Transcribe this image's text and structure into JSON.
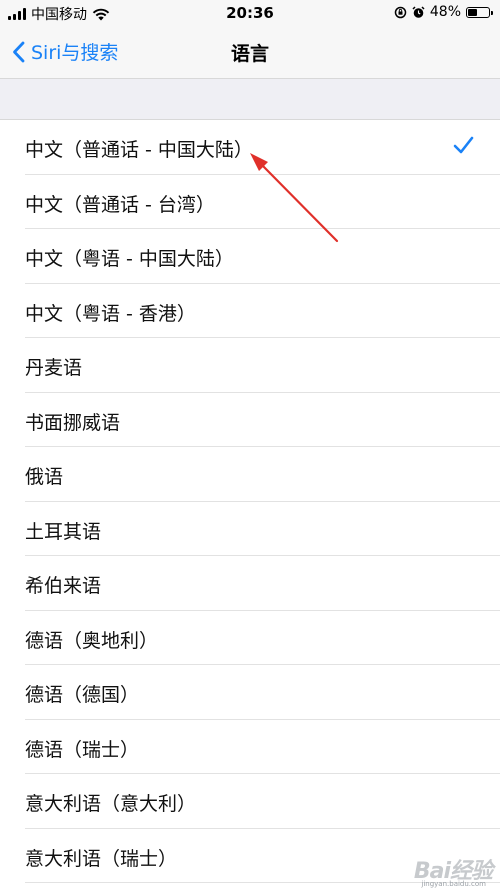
{
  "status_bar": {
    "carrier": "中国移动",
    "time": "20:36",
    "battery_percent": "48%",
    "battery_level": 0.48,
    "icons": [
      "signal-icon",
      "wifi-icon",
      "lock-rotation-icon",
      "alarm-icon",
      "battery-icon"
    ]
  },
  "nav": {
    "back_label": "Siri与搜索",
    "title": "语言"
  },
  "accent_color": "#1a82f7",
  "languages": [
    {
      "label": "中文（普通话 - 中国大陆）",
      "selected": true
    },
    {
      "label": "中文（普通话 - 台湾）",
      "selected": false
    },
    {
      "label": "中文（粤语 - 中国大陆）",
      "selected": false
    },
    {
      "label": "中文（粤语 - 香港）",
      "selected": false
    },
    {
      "label": "丹麦语",
      "selected": false
    },
    {
      "label": "书面挪威语",
      "selected": false
    },
    {
      "label": "俄语",
      "selected": false
    },
    {
      "label": "土耳其语",
      "selected": false
    },
    {
      "label": "希伯来语",
      "selected": false
    },
    {
      "label": "德语（奥地利）",
      "selected": false
    },
    {
      "label": "德语（德国）",
      "selected": false
    },
    {
      "label": "德语（瑞士）",
      "selected": false
    },
    {
      "label": "意大利语（意大利）",
      "selected": false
    },
    {
      "label": "意大利语（瑞士）",
      "selected": false
    }
  ],
  "annotation": {
    "color": "#e0302a"
  },
  "watermark": {
    "text": "Bai经验",
    "sub": "jingyan.baidu.com"
  }
}
